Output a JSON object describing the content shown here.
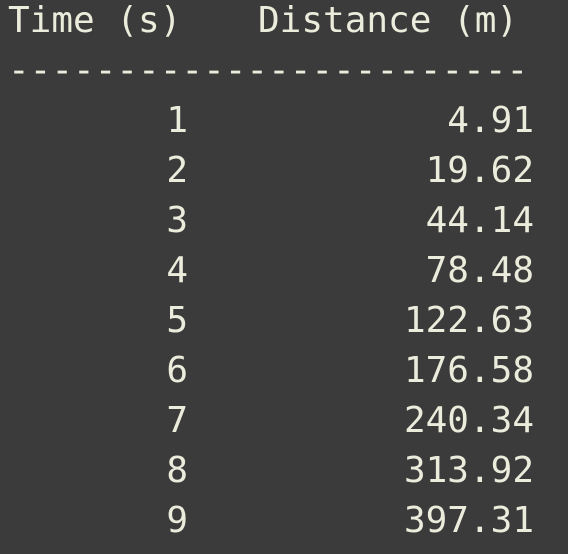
{
  "header": {
    "time_label": "Time (s)",
    "distance_label": "Distance (m)"
  },
  "separator": "------------------------",
  "rows": [
    {
      "time": "1",
      "distance": "4.91"
    },
    {
      "time": "2",
      "distance": "19.62"
    },
    {
      "time": "3",
      "distance": "44.14"
    },
    {
      "time": "4",
      "distance": "78.48"
    },
    {
      "time": "5",
      "distance": "122.63"
    },
    {
      "time": "6",
      "distance": "176.58"
    },
    {
      "time": "7",
      "distance": "240.34"
    },
    {
      "time": "8",
      "distance": "313.92"
    },
    {
      "time": "9",
      "distance": "397.31"
    }
  ],
  "colors": {
    "background": "#3b3b3b",
    "text": "#ececdc"
  }
}
